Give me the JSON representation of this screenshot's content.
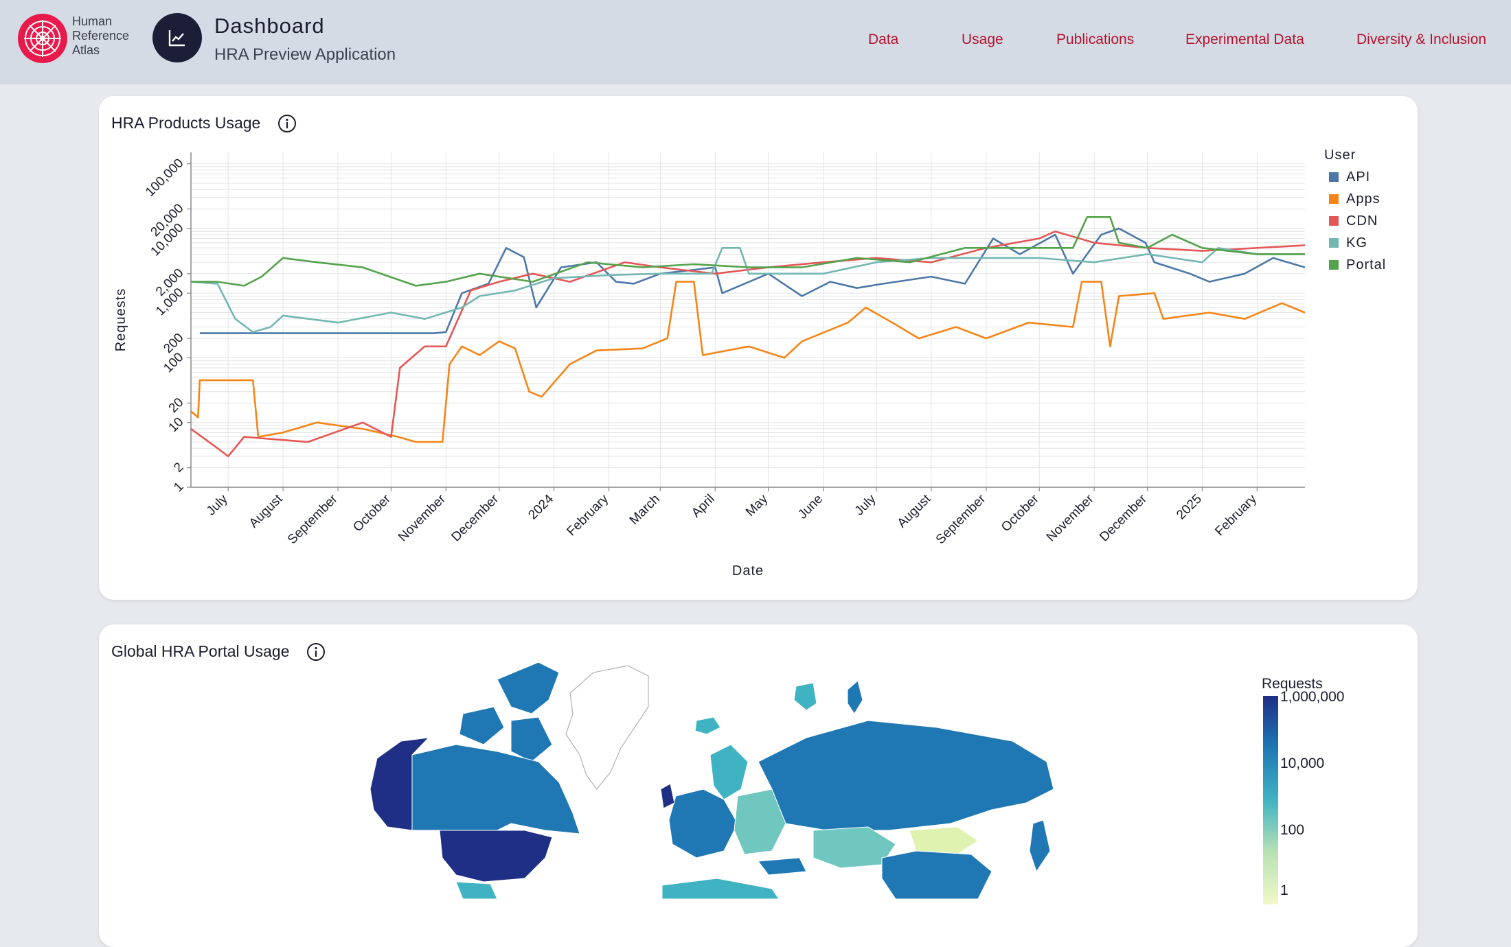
{
  "header": {
    "logo_lines": [
      "Human",
      "Reference",
      "Atlas"
    ],
    "title": "Dashboard",
    "subtitle": "HRA Preview Application",
    "nav": [
      "Data",
      "Usage",
      "Publications",
      "Experimental Data",
      "Diversity & Inclusion"
    ],
    "accent_color": "#b3132f",
    "logo_color": "#e8194b"
  },
  "usage_card": {
    "title": "HRA Products Usage"
  },
  "map_card": {
    "title": "Global HRA Portal Usage",
    "legend_title": "Requests",
    "legend_labels": [
      "1,000,000",
      "10,000",
      "100",
      "1"
    ]
  },
  "chart_data": {
    "type": "line",
    "xlabel": "Date",
    "ylabel": "Requests",
    "y_scale": "log",
    "ylim": [
      1,
      150000
    ],
    "y_ticks": [
      "1",
      "2",
      "10",
      "20",
      "100",
      "200",
      "1,000",
      "2,000",
      "10,000",
      "20,000",
      "100,000"
    ],
    "x_ticks": [
      "July",
      "August",
      "September",
      "October",
      "November",
      "December",
      "2024",
      "February",
      "March",
      "April",
      "May",
      "June",
      "July",
      "August",
      "September",
      "October",
      "November",
      "December",
      "2025",
      "February"
    ],
    "xlim": [
      "2023-06-10",
      "2025-02-28"
    ],
    "grid": true,
    "legend_title": "User",
    "legend_position": "right",
    "series": [
      {
        "name": "API",
        "color": "#4c78a8",
        "points": [
          [
            "2023-06-15",
            240
          ],
          [
            "2023-10-25",
            240
          ],
          [
            "2023-11-01",
            250
          ],
          [
            "2023-11-10",
            1000
          ],
          [
            "2023-11-25",
            1400
          ],
          [
            "2023-12-05",
            5000
          ],
          [
            "2023-12-15",
            3600
          ],
          [
            "2023-12-22",
            600
          ],
          [
            "2024-01-05",
            2500
          ],
          [
            "2024-01-25",
            3000
          ],
          [
            "2024-02-05",
            1500
          ],
          [
            "2024-02-15",
            1400
          ],
          [
            "2024-03-01",
            2000
          ],
          [
            "2024-04-01",
            2500
          ],
          [
            "2024-04-05",
            1000
          ],
          [
            "2024-05-01",
            2000
          ],
          [
            "2024-05-20",
            900
          ],
          [
            "2024-06-05",
            1500
          ],
          [
            "2024-06-20",
            1200
          ],
          [
            "2024-07-05",
            1400
          ],
          [
            "2024-08-01",
            1800
          ],
          [
            "2024-08-20",
            1400
          ],
          [
            "2024-09-05",
            7000
          ],
          [
            "2024-09-20",
            4000
          ],
          [
            "2024-10-10",
            8000
          ],
          [
            "2024-10-20",
            2000
          ],
          [
            "2024-11-05",
            8000
          ],
          [
            "2024-11-15",
            10000
          ],
          [
            "2024-11-30",
            6000
          ],
          [
            "2024-12-05",
            3000
          ],
          [
            "2024-12-25",
            2000
          ],
          [
            "2025-01-05",
            1500
          ],
          [
            "2025-01-25",
            2000
          ],
          [
            "2025-02-10",
            3500
          ],
          [
            "2025-02-28",
            2500
          ]
        ]
      },
      {
        "name": "Apps",
        "color": "#f58518",
        "points": [
          [
            "2023-06-10",
            15
          ],
          [
            "2023-06-14",
            12
          ],
          [
            "2023-06-15",
            45
          ],
          [
            "2023-07-15",
            45
          ],
          [
            "2023-07-18",
            6
          ],
          [
            "2023-08-01",
            7
          ],
          [
            "2023-08-20",
            10
          ],
          [
            "2023-09-15",
            8
          ],
          [
            "2023-10-05",
            6
          ],
          [
            "2023-10-15",
            5
          ],
          [
            "2023-10-30",
            5
          ],
          [
            "2023-11-03",
            80
          ],
          [
            "2023-11-10",
            150
          ],
          [
            "2023-11-20",
            110
          ],
          [
            "2023-12-01",
            180
          ],
          [
            "2023-12-10",
            140
          ],
          [
            "2023-12-18",
            30
          ],
          [
            "2023-12-25",
            25
          ],
          [
            "2024-01-10",
            80
          ],
          [
            "2024-01-25",
            130
          ],
          [
            "2024-02-20",
            140
          ],
          [
            "2024-03-05",
            200
          ],
          [
            "2024-03-10",
            1500
          ],
          [
            "2024-03-20",
            1500
          ],
          [
            "2024-03-25",
            110
          ],
          [
            "2024-04-20",
            150
          ],
          [
            "2024-05-10",
            100
          ],
          [
            "2024-05-20",
            180
          ],
          [
            "2024-06-15",
            350
          ],
          [
            "2024-06-25",
            600
          ],
          [
            "2024-07-10",
            350
          ],
          [
            "2024-07-25",
            200
          ],
          [
            "2024-08-15",
            300
          ],
          [
            "2024-09-01",
            200
          ],
          [
            "2024-09-25",
            350
          ],
          [
            "2024-10-20",
            300
          ],
          [
            "2024-10-25",
            1500
          ],
          [
            "2024-11-05",
            1500
          ],
          [
            "2024-11-10",
            150
          ],
          [
            "2024-11-15",
            900
          ],
          [
            "2024-12-05",
            1000
          ],
          [
            "2024-12-10",
            400
          ],
          [
            "2025-01-05",
            500
          ],
          [
            "2025-01-25",
            400
          ],
          [
            "2025-02-15",
            700
          ],
          [
            "2025-02-28",
            500
          ]
        ]
      },
      {
        "name": "CDN",
        "color": "#e45756",
        "points": [
          [
            "2023-06-10",
            8
          ],
          [
            "2023-06-25",
            4
          ],
          [
            "2023-07-01",
            3
          ],
          [
            "2023-07-10",
            6
          ],
          [
            "2023-08-15",
            5
          ],
          [
            "2023-09-15",
            10
          ],
          [
            "2023-10-01",
            6
          ],
          [
            "2023-10-06",
            70
          ],
          [
            "2023-10-20",
            150
          ],
          [
            "2023-11-01",
            150
          ],
          [
            "2023-11-15",
            1100
          ],
          [
            "2023-12-01",
            1500
          ],
          [
            "2023-12-20",
            2000
          ],
          [
            "2024-01-10",
            1500
          ],
          [
            "2024-02-10",
            3000
          ],
          [
            "2024-03-01",
            2500
          ],
          [
            "2024-04-01",
            2000
          ],
          [
            "2024-05-01",
            2500
          ],
          [
            "2024-06-01",
            3000
          ],
          [
            "2024-07-01",
            3500
          ],
          [
            "2024-08-01",
            3000
          ],
          [
            "2024-09-01",
            5000
          ],
          [
            "2024-10-01",
            7000
          ],
          [
            "2024-10-10",
            9000
          ],
          [
            "2024-11-01",
            6000
          ],
          [
            "2024-12-01",
            5000
          ],
          [
            "2025-01-01",
            4500
          ],
          [
            "2025-02-01",
            5000
          ],
          [
            "2025-02-28",
            5500
          ]
        ]
      },
      {
        "name": "KG",
        "color": "#72b7b2",
        "points": [
          [
            "2023-06-10",
            1500
          ],
          [
            "2023-06-25",
            1400
          ],
          [
            "2023-07-05",
            400
          ],
          [
            "2023-07-15",
            250
          ],
          [
            "2023-07-25",
            300
          ],
          [
            "2023-08-01",
            450
          ],
          [
            "2023-09-01",
            350
          ],
          [
            "2023-10-01",
            500
          ],
          [
            "2023-10-20",
            400
          ],
          [
            "2023-11-10",
            600
          ],
          [
            "2023-11-20",
            900
          ],
          [
            "2023-12-10",
            1100
          ],
          [
            "2024-01-01",
            1700
          ],
          [
            "2024-02-01",
            1900
          ],
          [
            "2024-03-01",
            2000
          ],
          [
            "2024-03-30",
            2000
          ],
          [
            "2024-04-05",
            5000
          ],
          [
            "2024-04-15",
            5000
          ],
          [
            "2024-04-20",
            2000
          ],
          [
            "2024-06-01",
            2000
          ],
          [
            "2024-07-01",
            3000
          ],
          [
            "2024-08-01",
            3500
          ],
          [
            "2024-09-01",
            3500
          ],
          [
            "2024-10-01",
            3500
          ],
          [
            "2024-11-01",
            3000
          ],
          [
            "2024-12-01",
            4000
          ],
          [
            "2025-01-01",
            3000
          ],
          [
            "2025-01-10",
            5000
          ],
          [
            "2025-02-01",
            4000
          ],
          [
            "2025-02-28",
            4000
          ]
        ]
      },
      {
        "name": "Portal",
        "color": "#54a24b",
        "points": [
          [
            "2023-06-10",
            1500
          ],
          [
            "2023-06-25",
            1500
          ],
          [
            "2023-07-10",
            1300
          ],
          [
            "2023-07-20",
            1800
          ],
          [
            "2023-08-01",
            3500
          ],
          [
            "2023-08-20",
            3000
          ],
          [
            "2023-09-15",
            2500
          ],
          [
            "2023-10-15",
            1300
          ],
          [
            "2023-11-01",
            1500
          ],
          [
            "2023-11-20",
            2000
          ],
          [
            "2023-12-20",
            1500
          ],
          [
            "2024-01-20",
            3000
          ],
          [
            "2024-02-20",
            2500
          ],
          [
            "2024-03-20",
            2800
          ],
          [
            "2024-04-20",
            2500
          ],
          [
            "2024-05-20",
            2500
          ],
          [
            "2024-06-20",
            3500
          ],
          [
            "2024-07-20",
            3000
          ],
          [
            "2024-08-20",
            5000
          ],
          [
            "2024-09-20",
            5000
          ],
          [
            "2024-10-20",
            5000
          ],
          [
            "2024-10-28",
            15000
          ],
          [
            "2024-11-10",
            15000
          ],
          [
            "2024-11-15",
            6000
          ],
          [
            "2024-12-01",
            5000
          ],
          [
            "2024-12-15",
            8000
          ],
          [
            "2025-01-01",
            5000
          ],
          [
            "2025-02-01",
            4000
          ],
          [
            "2025-02-28",
            4000
          ]
        ]
      }
    ]
  }
}
